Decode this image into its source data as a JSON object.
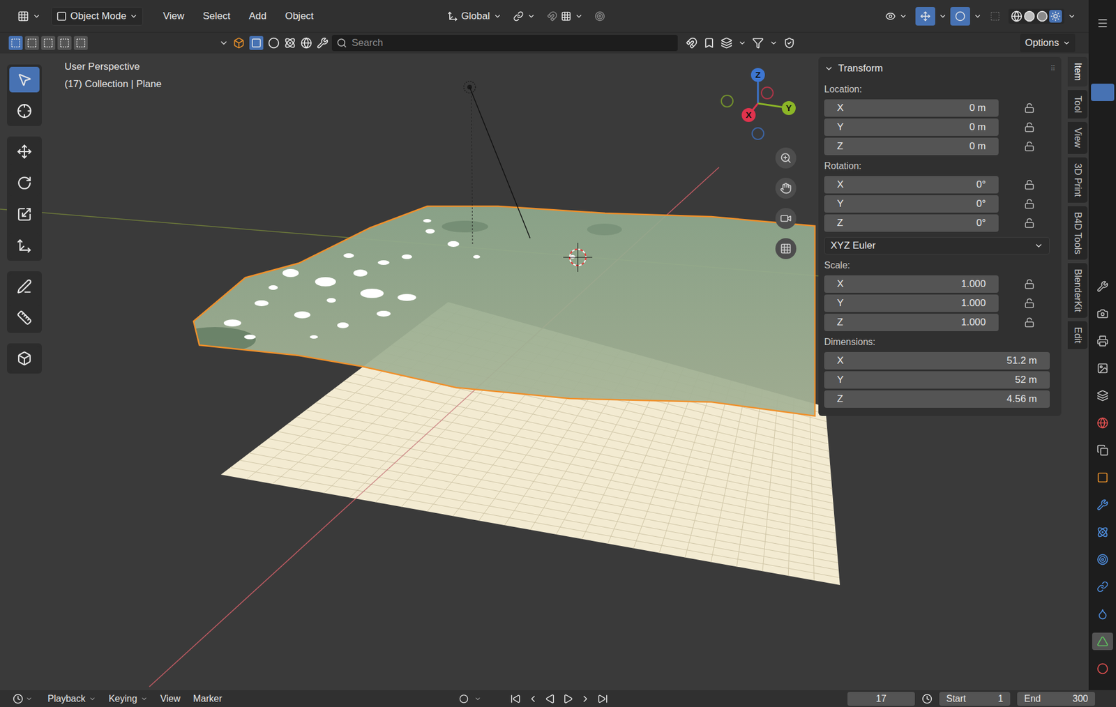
{
  "header": {
    "mode": "Object Mode",
    "menus": [
      "View",
      "Select",
      "Add",
      "Object"
    ],
    "orientation": "Global"
  },
  "tool_header": {
    "search_placeholder": "Search",
    "options": "Options"
  },
  "viewport": {
    "view_name": "User Perspective",
    "object_info": "(17) Collection | Plane",
    "terrain_selected": true,
    "gizmo": [
      {
        "label": "Z",
        "color": "#3d76d1"
      },
      {
        "label": "Y",
        "color": "#8cb627"
      },
      {
        "label": "X",
        "color": "#e0334d"
      }
    ]
  },
  "tools": [
    {
      "selected": true
    },
    {
      "selected": false
    },
    {
      "selected": false
    },
    {
      "selected": false
    },
    {
      "selected": false
    },
    {
      "selected": false
    },
    {
      "selected": false
    },
    {
      "selected": false
    },
    {
      "selected": false
    }
  ],
  "sidebar_tabs": [
    {
      "label": "Item",
      "selected": true
    },
    {
      "label": "Tool",
      "selected": false
    },
    {
      "label": "View",
      "selected": false
    },
    {
      "label": "3D Print",
      "selected": false
    },
    {
      "label": "B4D Tools",
      "selected": false
    },
    {
      "label": "BlenderKit",
      "selected": false
    },
    {
      "label": "Edit",
      "selected": false
    }
  ],
  "transform": {
    "title": "Transform",
    "sections": [
      {
        "kind": "fields",
        "label": "Location:",
        "fields": [
          {
            "axis": "X",
            "value": "0 m",
            "locked": false
          },
          {
            "axis": "Y",
            "value": "0 m",
            "locked": false
          },
          {
            "axis": "Z",
            "value": "0 m",
            "locked": false
          }
        ]
      },
      {
        "kind": "fields",
        "label": "Rotation:",
        "fields": [
          {
            "axis": "X",
            "value": "0°",
            "locked": false
          },
          {
            "axis": "Y",
            "value": "0°",
            "locked": false
          },
          {
            "axis": "Z",
            "value": "0°",
            "locked": false
          }
        ]
      },
      {
        "kind": "dropdown",
        "value": "XYZ Euler"
      },
      {
        "kind": "fields",
        "label": "Scale:",
        "fields": [
          {
            "axis": "X",
            "value": "1.000",
            "locked": false
          },
          {
            "axis": "Y",
            "value": "1.000",
            "locked": false
          },
          {
            "axis": "Z",
            "value": "1.000",
            "locked": false
          }
        ]
      },
      {
        "kind": "fields",
        "label": "Dimensions:",
        "fields": [
          {
            "axis": "X",
            "value": "51.2 m"
          },
          {
            "axis": "Y",
            "value": "52 m"
          },
          {
            "axis": "Z",
            "value": "4.56 m"
          }
        ]
      }
    ]
  },
  "properties_tabs": [
    {
      "selected": false
    },
    {
      "selected": false
    },
    {
      "selected": false
    },
    {
      "selected": false
    },
    {
      "selected": false
    },
    {
      "selected": false
    },
    {
      "selected": false
    },
    {
      "selected": false
    },
    {
      "selected": false
    },
    {
      "selected": false
    },
    {
      "selected": false
    },
    {
      "selected": false
    },
    {
      "selected": false
    },
    {
      "selected": true
    },
    {
      "selected": false
    }
  ],
  "timeline": {
    "menus": [
      {
        "label": "Playback",
        "dropdown": true
      },
      {
        "label": "Keying",
        "dropdown": true
      },
      {
        "label": "View",
        "dropdown": false
      },
      {
        "label": "Marker",
        "dropdown": false
      }
    ],
    "current_frame": "17",
    "start_label": "Start",
    "start": "1",
    "end_label": "End",
    "end": "300"
  }
}
